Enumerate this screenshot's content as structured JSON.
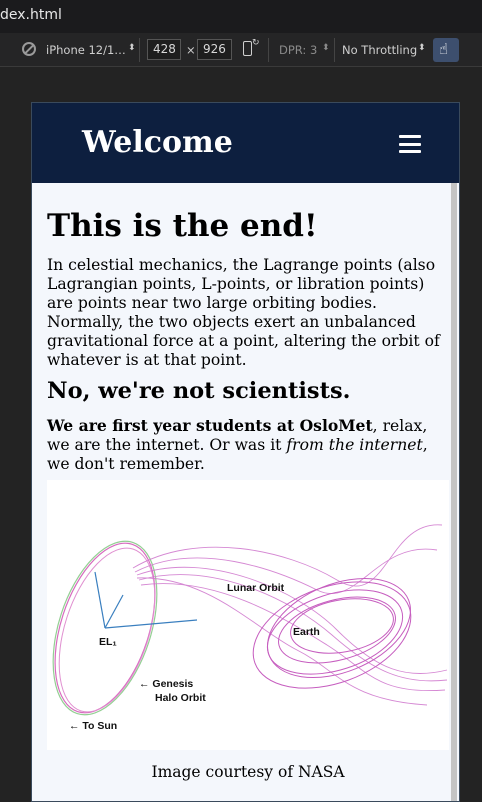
{
  "browser": {
    "tab_title": "dex.html",
    "device_name": "iPhone 12/1…",
    "width": "428",
    "times": "×",
    "height": "926",
    "dpr": "DPR: 3",
    "throttling": "No Throttling"
  },
  "site": {
    "header_title": "Welcome",
    "heading": "This is the end!",
    "intro": "In celestial mechanics, the Lagrange points (also Lagrangian points, L-points, or libration points) are points near two large orbiting bodies. Normally, the two objects exert an unbalanced gravitational force at a point, altering the orbit of whatever is at that point.",
    "subheading": "No, we're not scientists.",
    "para2_bold": "We are first year students at OsloMet",
    "para2_mid": ", relax, we are the internet. Or was it ",
    "para2_italic": "from the internet",
    "para2_end": ", we don't remember.",
    "figure": {
      "label_lunar": "Lunar Orbit",
      "label_earth": "Earth",
      "label_el1": "EL₁",
      "label_genesis_1": "← Genesis",
      "label_genesis_2": "Halo Orbit",
      "label_sun": "← To Sun"
    },
    "caption": "Image courtesy of NASA"
  }
}
